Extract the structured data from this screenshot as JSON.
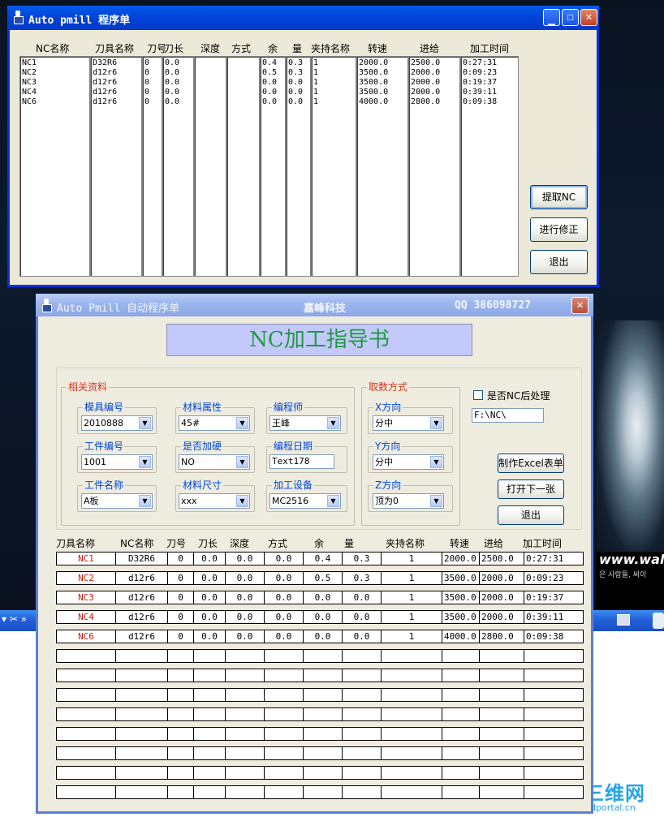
{
  "window1": {
    "title": "Auto pmill 程序单",
    "columns": [
      "NC名称",
      "刀具名称",
      "刀号",
      "刀长",
      "深度",
      "方式",
      "余",
      "量",
      "夹持名称",
      "转速",
      "进给",
      "加工时间"
    ],
    "rows": [
      [
        "NC1",
        "D32R6",
        "0",
        "0.0",
        "",
        "",
        "0.4",
        "0.3",
        "1",
        "2000.0",
        "2500.0",
        "0:27:31"
      ],
      [
        "NC2",
        "d12r6",
        "0",
        "0.0",
        "",
        "",
        "0.5",
        "0.3",
        "1",
        "3500.0",
        "2000.0",
        "0:09:23"
      ],
      [
        "NC3",
        "d12r6",
        "0",
        "0.0",
        "",
        "",
        "0.0",
        "0.0",
        "1",
        "3500.0",
        "2000.0",
        "0:19:37"
      ],
      [
        "NC4",
        "d12r6",
        "0",
        "0.0",
        "",
        "",
        "0.0",
        "0.0",
        "1",
        "3500.0",
        "2000.0",
        "0:39:11"
      ],
      [
        "NC6",
        "d12r6",
        "0",
        "0.0",
        "",
        "",
        "0.0",
        "0.0",
        "1",
        "4000.0",
        "2800.0",
        "0:09:38"
      ]
    ],
    "buttons": {
      "extract": "提取NC",
      "modify": "进行修正",
      "exit": "退出"
    }
  },
  "window2": {
    "title": "Auto Pmill 自动程序单",
    "company": "嘉峰科技",
    "qq": "QQ 386098727",
    "banner": "NC加工指导书",
    "info_group": "相关资料",
    "fields": {
      "mold_no_label": "模具编号",
      "mold_no": "2010888",
      "material_label": "材料属性",
      "material": "45#",
      "programmer_label": "编程师",
      "programmer": "王峰",
      "part_no_label": "工件编号",
      "part_no": "1001",
      "hardened_label": "是否加硬",
      "hardened": "NO",
      "date_label": "编程日期",
      "date": "Text178",
      "part_name_label": "工件名称",
      "part_name": "A板",
      "size_label": "材料尺寸",
      "size": "xxx",
      "machine_label": "加工设备",
      "machine": "MC2516"
    },
    "take_group": "取数方式",
    "take": {
      "x_label": "X方向",
      "x_value": "分中",
      "y_label": "Y方向",
      "y_value": "分中",
      "z_label": "Z方向",
      "z_value": "顶为0"
    },
    "post_checkbox_label": "是否NC后处理",
    "post_checked": false,
    "path_value": "F:\\NC\\",
    "buttons": {
      "excel": "制作Excel表单",
      "next": "打开下一张",
      "exit": "退出"
    },
    "grid_columns": [
      "刀具名称",
      "NC名称",
      "刀号",
      "刀长",
      "深度",
      "方式",
      "余",
      "量",
      "夹持名称",
      "转速",
      "进给",
      "加工时间"
    ],
    "grid_rows": [
      [
        "NC1",
        "D32R6",
        "0",
        "0.0",
        "0.0",
        "0.0",
        "0.4",
        "0.3",
        "1",
        "2000.0",
        "2500.0",
        "0:27:31"
      ],
      [
        "NC2",
        "d12r6",
        "0",
        "0.0",
        "0.0",
        "0.0",
        "0.5",
        "0.3",
        "1",
        "3500.0",
        "2000.0",
        "0:09:23"
      ],
      [
        "NC3",
        "d12r6",
        "0",
        "0.0",
        "0.0",
        "0.0",
        "0.0",
        "0.0",
        "1",
        "3500.0",
        "2000.0",
        "0:19:37"
      ],
      [
        "NC4",
        "d12r6",
        "0",
        "0.0",
        "0.0",
        "0.0",
        "0.0",
        "0.0",
        "1",
        "3500.0",
        "2000.0",
        "0:39:11"
      ],
      [
        "NC6",
        "d12r6",
        "0",
        "0.0",
        "0.0",
        "0.0",
        "0.0",
        "0.0",
        "1",
        "4000.0",
        "2800.0",
        "0:09:38"
      ]
    ],
    "empty_rows": 8
  },
  "desktop": {
    "wallpaper_text": "www.wallc",
    "wallpaper_sub": "은 사람들, 써이",
    "watermark": "三维网",
    "watermark_sub": "3dportal.cn"
  }
}
